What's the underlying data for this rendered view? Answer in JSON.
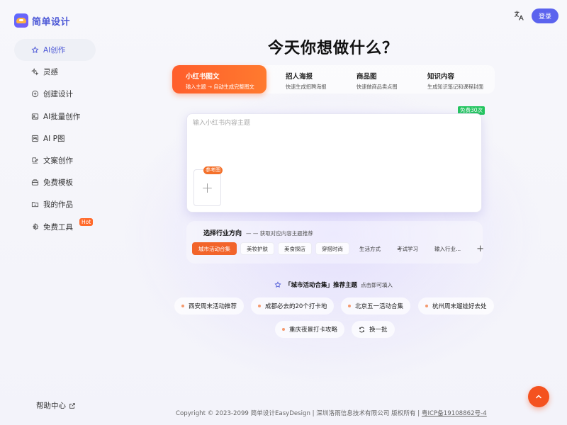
{
  "brand": {
    "name": "简单设计"
  },
  "header": {
    "login": "登录",
    "translate_icon": "translate-icon"
  },
  "sidebar": {
    "items": [
      {
        "label": "AI创作",
        "icon": "star-icon",
        "active": true
      },
      {
        "label": "灵感",
        "icon": "sparkle-icon"
      },
      {
        "label": "创建设计",
        "icon": "plus-circle-icon"
      },
      {
        "label": "AI批量创作",
        "icon": "image-icon"
      },
      {
        "label": "AI P图",
        "icon": "ps-icon"
      },
      {
        "label": "文案创作",
        "icon": "edit-icon"
      },
      {
        "label": "免费模板",
        "icon": "template-icon"
      },
      {
        "label": "我的作品",
        "icon": "folder-icon"
      },
      {
        "label": "免费工具",
        "icon": "gear-icon",
        "badge": "Hot"
      }
    ],
    "help": "帮助中心"
  },
  "main": {
    "title": "今天你想做什么？",
    "tabs": [
      {
        "title": "小红书图文",
        "sub": "输入主题 → 自动生成完整图文",
        "active": true
      },
      {
        "title": "招人海报",
        "sub": "快速生成招聘海报"
      },
      {
        "title": "商品图",
        "sub": "快速做商品卖点图"
      },
      {
        "title": "知识内容",
        "sub": "生成知识笔记和课程封面"
      }
    ],
    "editor": {
      "placeholder": "输入小红书内容主题",
      "free_badge": "免费30次",
      "ref_tag": "参考图",
      "upload_plus": "+"
    },
    "industry": {
      "title": "选择行业方向",
      "sub": "— — 获取对应内容主题推荐",
      "chips": [
        "城市活动合集",
        "美妆护肤",
        "美食探店",
        "穿搭时尚",
        "生活方式",
        "考试学习",
        "输入行业..."
      ],
      "add": "+"
    },
    "recommend": {
      "title": "「城市活动合集」推荐主题",
      "sub": "点击即可填入",
      "items": [
        "西安周末活动推荐",
        "成都必去的20个打卡地",
        "北京五一活动合集",
        "杭州周末遛娃好去处",
        "重庆夜景打卡攻略"
      ],
      "refresh": "换一批"
    }
  },
  "footer": {
    "text": "Copyright © 2023-2099 简单设计EasyDesign | 深圳洛雨信息技术有限公司 版权所有 | ",
    "icp": "粤ICP备19108862号-4"
  },
  "colors": {
    "accent": "#5b63ee",
    "orange": "#f4521f",
    "green": "#22c55e"
  }
}
